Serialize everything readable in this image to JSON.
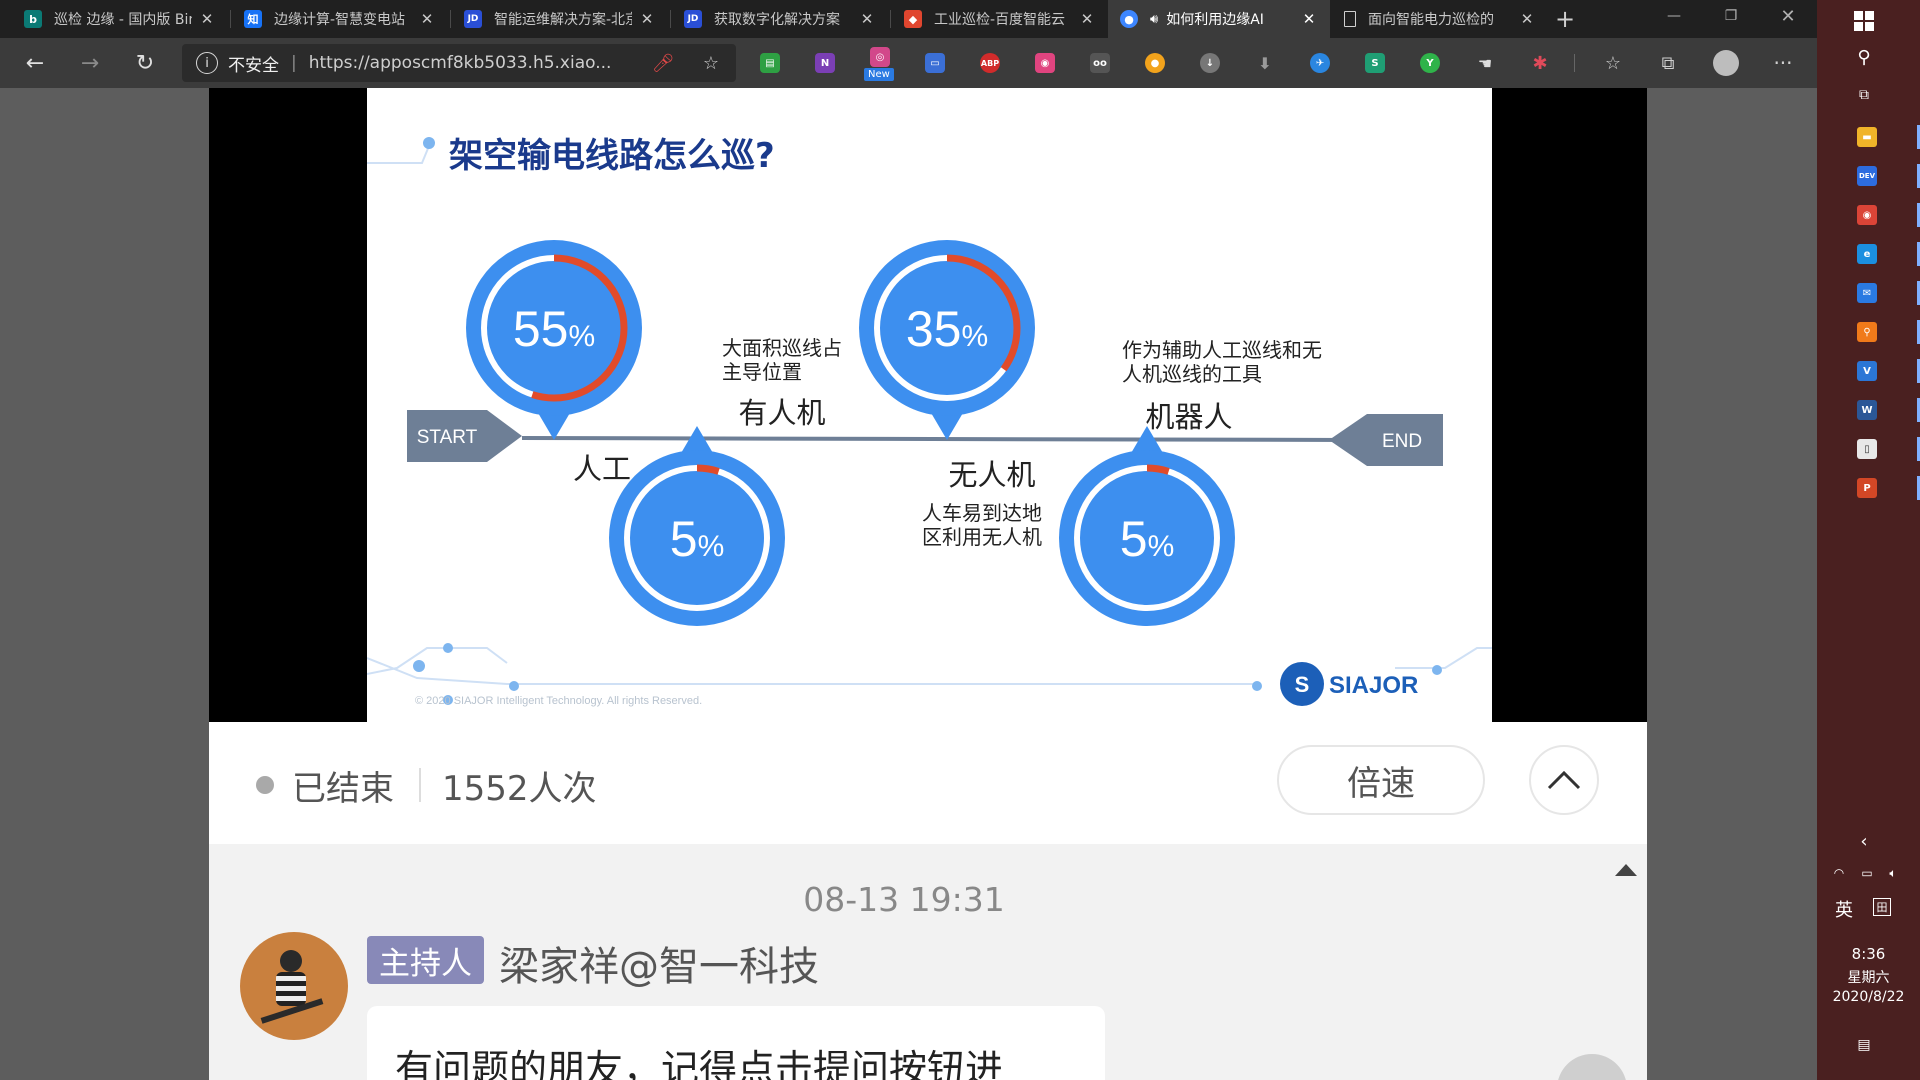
{
  "tabs": [
    {
      "title": "巡检 边缘 - 国内版 Bing",
      "favicon": "bing-icon",
      "color": "#0b7a75",
      "glyph": "b"
    },
    {
      "title": "边缘计算-智慧变电站",
      "favicon": "zhihu-icon",
      "color": "#1772f6",
      "glyph": "知"
    },
    {
      "title": "智能运维解决方案-北京",
      "favicon": "jd-icon",
      "color": "#2a4fd6",
      "glyph": "JD"
    },
    {
      "title": "获取数字化解决方案",
      "favicon": "jd-icon",
      "color": "#2a4fd6",
      "glyph": "JD"
    },
    {
      "title": "工业巡检-百度智能云",
      "favicon": "baidu-cloud-icon",
      "color": "#e0462f",
      "glyph": "◆"
    },
    {
      "title": "如何利用边缘AI",
      "favicon": "live-icon",
      "color": "#3d86ff",
      "glyph": "●"
    },
    {
      "title": "面向智能电力巡检的",
      "favicon": "document-icon",
      "color": "#3b3b3b",
      "glyph": "▢"
    }
  ],
  "address_bar": {
    "insecure_label": "不安全",
    "url": "https://apposcmf8kb5033.h5.xiao..."
  },
  "extensions": [
    {
      "name": "printer-ext-icon",
      "color": "#2ea043",
      "glyph": "▤"
    },
    {
      "name": "onenote-ext-icon",
      "color": "#7b3fb5",
      "glyph": "N"
    },
    {
      "name": "new-badge-ext-icon",
      "color": "#d2488a",
      "glyph": "◎"
    },
    {
      "name": "card-ext-icon",
      "color": "#3b6fd6",
      "glyph": "▭"
    },
    {
      "name": "adblock-ext-icon",
      "color": "#d12b2b",
      "glyph": "ABP"
    },
    {
      "name": "camera-ext-icon",
      "color": "#e0447f",
      "glyph": "◉"
    },
    {
      "name": "glasses-ext-icon",
      "color": "#555555",
      "glyph": "oo"
    },
    {
      "name": "color-ext-icon",
      "color": "#f2a31c",
      "glyph": "●"
    },
    {
      "name": "download-circle-ext-icon",
      "color": "#777777",
      "glyph": "↓"
    },
    {
      "name": "download-ext-icon",
      "color": "#3b3b3b",
      "glyph": "⬇"
    },
    {
      "name": "compass-ext-icon",
      "color": "#2a86e0",
      "glyph": "✈"
    },
    {
      "name": "s-ext-icon",
      "color": "#1f9e74",
      "glyph": "S"
    },
    {
      "name": "y-ext-icon",
      "color": "#2fb34a",
      "glyph": "Y"
    },
    {
      "name": "hand-ext-icon",
      "color": "#3b3b3b",
      "glyph": "☚"
    },
    {
      "name": "pinwheel-ext-icon",
      "color": "#e04a5a",
      "glyph": "✱"
    }
  ],
  "new_badge": "New",
  "slide": {
    "title": "架空输电线路怎么巡?",
    "start": "START",
    "end": "END",
    "items": [
      {
        "percent": "55",
        "unit": "%",
        "fraction": 0.55,
        "label": "人工"
      },
      {
        "percent": "5",
        "unit": "%",
        "fraction": 0.05,
        "label": "有人机",
        "note_lines": [
          "大面积巡线占",
          "主导位置"
        ]
      },
      {
        "percent": "35",
        "unit": "%",
        "fraction": 0.35,
        "label": "无人机",
        "note_lines": [
          "人车易到达地",
          "区利用无人机"
        ]
      },
      {
        "percent": "5",
        "unit": "%",
        "fraction": 0.05,
        "label": "机器人",
        "note_lines": [
          "作为辅助人工巡线和无",
          "人机巡线的工具"
        ]
      }
    ],
    "copyright": "© 2020 SIAJOR Intelligent Technology. All rights Reserved.",
    "logo": "SIAJOR",
    "colors": {
      "blue": "#3d8fef",
      "red": "#e14b2a",
      "title": "#1a3a8c",
      "timeline": "#6e7f96"
    }
  },
  "status": {
    "state": "已结束",
    "views": "1552人次",
    "speed_button": "倍速"
  },
  "chat": {
    "timestamp": "08-13 19:31",
    "role_badge": "主持人",
    "author": "梁家祥@智一科技",
    "message": "有问题的朋友，记得点击提问按钮进"
  },
  "taskbar": {
    "input_lang": "英",
    "time": "8:36",
    "weekday": "星期六",
    "date": "2020/8/22",
    "apps": [
      {
        "name": "file-explorer-icon",
        "color": "#f0b429",
        "glyph": "▬"
      },
      {
        "name": "dev-tool-icon",
        "color": "#2d6cdf",
        "glyph": "DEV"
      },
      {
        "name": "chrome-icon",
        "color": "#db4437",
        "glyph": "◉"
      },
      {
        "name": "edge-icon",
        "color": "#1b8fe0",
        "glyph": "e"
      },
      {
        "name": "mail-icon",
        "color": "#2a7ae2",
        "glyph": "✉"
      },
      {
        "name": "search-app-icon",
        "color": "#f07a1a",
        "glyph": "⚲"
      },
      {
        "name": "vs-icon",
        "color": "#2b76d6",
        "glyph": "V"
      },
      {
        "name": "word-icon",
        "color": "#2b5797",
        "glyph": "W"
      },
      {
        "name": "notes-icon",
        "color": "#e8e8e8",
        "glyph": "▯"
      },
      {
        "name": "powerpoint-icon",
        "color": "#d24726",
        "glyph": "P"
      }
    ]
  }
}
